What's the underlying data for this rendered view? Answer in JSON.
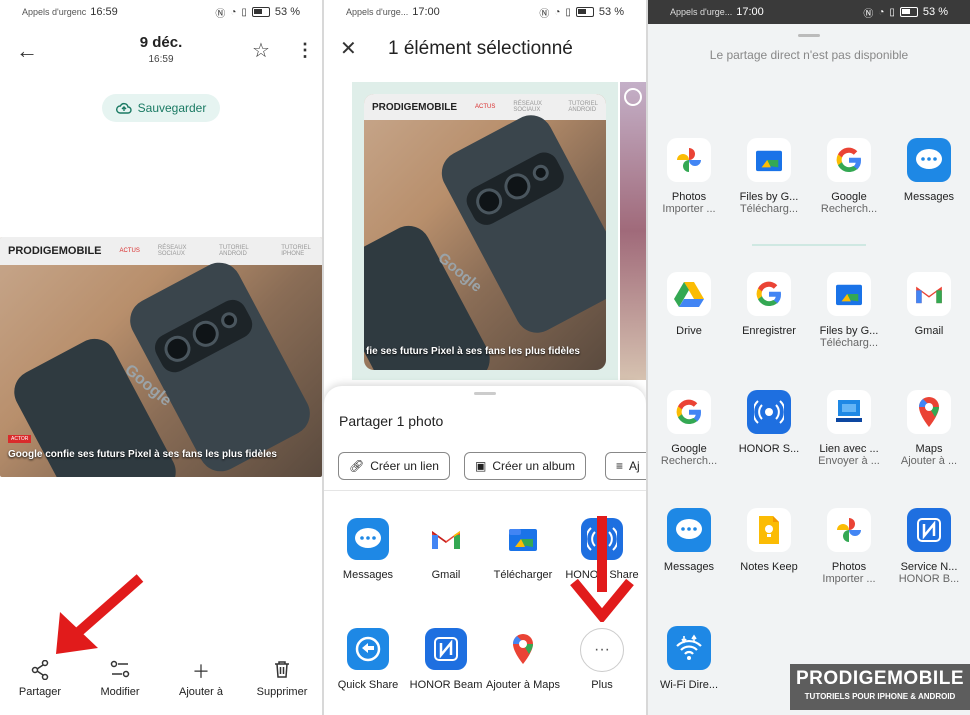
{
  "panel1": {
    "status": {
      "carrier": "Appels d'urgenc",
      "time": "16:59",
      "battery": "53 %"
    },
    "header": {
      "date": "9 déc.",
      "time": "16:59"
    },
    "save_button": "Sauvegarder",
    "photo": {
      "site_logo": "PRODIGEMOBILE",
      "nav": [
        "ACTUS",
        "RÉSEAUX SOCIAUX",
        "TUTORIEL ANDROID",
        "TUTORIEL IPHONE"
      ],
      "tag": "ACTOR",
      "caption": "Google confie ses futurs Pixel à ses fans les plus fidèles",
      "phone_brand": "Google"
    },
    "actions": [
      {
        "label": "Partager",
        "icon": "share-icon"
      },
      {
        "label": "Modifier",
        "icon": "adjust-icon"
      },
      {
        "label": "Ajouter à",
        "icon": "plus-icon"
      },
      {
        "label": "Supprimer",
        "icon": "trash-icon"
      }
    ]
  },
  "panel2": {
    "status": {
      "carrier": "Appels d'urge...",
      "time": "17:00",
      "battery": "53 %"
    },
    "title": "1 élément sélectionné",
    "photo": {
      "site_logo": "PRODIGEMOBILE",
      "nav": [
        "ACTUS",
        "RÉSEAUX SOCIAUX",
        "TUTORIEL ANDROID"
      ],
      "caption": "fie ses futurs Pixel à ses fans les plus fidèles",
      "phone_brand": "Google"
    },
    "sheet_title": "Partager 1 photo",
    "chips": [
      "Créer un lien",
      "Créer un album",
      "Aj"
    ],
    "apps": [
      {
        "label": "Messages",
        "icon": "messages-icon"
      },
      {
        "label": "Gmail",
        "icon": "gmail-icon"
      },
      {
        "label": "Télécharger",
        "icon": "files-icon"
      },
      {
        "label": "HONOR Share",
        "icon": "honor-share-icon"
      },
      {
        "label": "Quick Share",
        "icon": "quick-share-icon"
      },
      {
        "label": "HONOR Beam",
        "icon": "nfc-icon"
      },
      {
        "label": "Ajouter à Maps",
        "icon": "maps-icon"
      },
      {
        "label": "Plus",
        "icon": "more-icon"
      }
    ]
  },
  "panel3": {
    "status": {
      "carrier": "Appels d'urge...",
      "time": "17:00",
      "battery": "53 %"
    },
    "note": "Le partage direct n'est pas disponible",
    "apps": [
      {
        "label": "Photos",
        "sub": "Importer ...",
        "icon": "photos-icon"
      },
      {
        "label": "Files by G...",
        "sub": "Télécharg...",
        "icon": "files-icon"
      },
      {
        "label": "Google",
        "sub": "Recherch...",
        "icon": "google-icon"
      },
      {
        "label": "Messages",
        "sub": "",
        "icon": "messages-icon"
      },
      {
        "label": "Drive",
        "sub": "",
        "icon": "drive-icon"
      },
      {
        "label": "Enregistrer",
        "sub": "",
        "icon": "google-icon"
      },
      {
        "label": "Files by G...",
        "sub": "Télécharg...",
        "icon": "files-icon"
      },
      {
        "label": "Gmail",
        "sub": "",
        "icon": "gmail-icon"
      },
      {
        "label": "Google",
        "sub": "Recherch...",
        "icon": "google-icon"
      },
      {
        "label": "HONOR S...",
        "sub": "",
        "icon": "honor-share-icon"
      },
      {
        "label": "Lien avec ...",
        "sub": "Envoyer à ...",
        "icon": "link-to-windows-icon"
      },
      {
        "label": "Maps",
        "sub": "Ajouter à ...",
        "icon": "maps-icon"
      },
      {
        "label": "Messages",
        "sub": "",
        "icon": "messages-icon"
      },
      {
        "label": "Notes Keep",
        "sub": "",
        "icon": "keep-icon"
      },
      {
        "label": "Photos",
        "sub": "Importer ...",
        "icon": "photos-icon"
      },
      {
        "label": "Service N...",
        "sub": "HONOR B...",
        "icon": "nfc-icon"
      },
      {
        "label": "Wi-Fi Dire...",
        "sub": "",
        "icon": "wifi-direct-icon"
      }
    ]
  },
  "watermark": {
    "title": "PRODIGEMOBILE",
    "subtitle": "TUTORIELS POUR IPHONE & ANDROID"
  },
  "colors": {
    "accent_green": "#1a7a63",
    "arrow_red": "#e11b1b",
    "honor_blue": "#1e6fe0"
  }
}
